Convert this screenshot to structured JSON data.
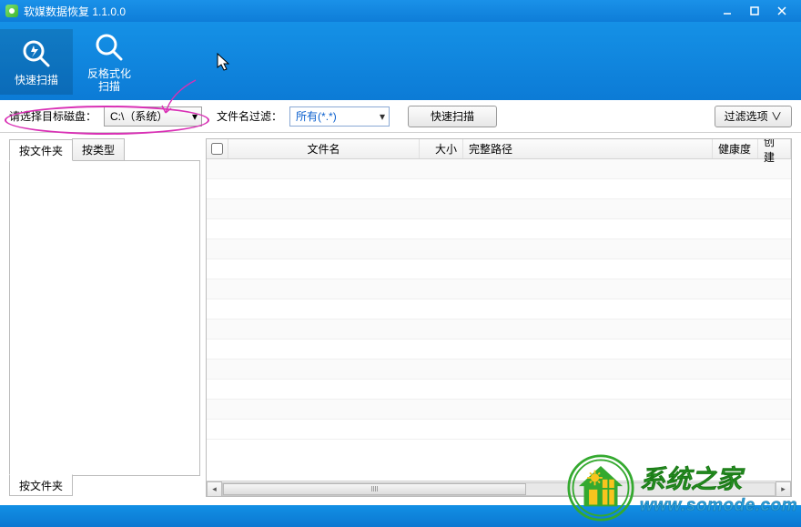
{
  "window": {
    "title": "软媒数据恢复 1.1.0.0"
  },
  "toolbar": {
    "quick_scan": "快速扫描",
    "unformat_line1": "反格式化",
    "unformat_line2": "扫描"
  },
  "filterbar": {
    "disk_label": "请选择目标磁盘：",
    "disk_value": "C:\\（系统）",
    "file_filter_label": "文件名过滤：",
    "file_filter_value": "所有(*.*)",
    "scan_btn": "快速扫描",
    "options_btn": "过滤选项 ∨"
  },
  "tabs": {
    "by_folder": "按文件夹",
    "by_type": "按类型"
  },
  "columns": {
    "filename": "文件名",
    "size": "大小",
    "fullpath": "完整路径",
    "health": "健康度",
    "created": "创建"
  },
  "watermark": {
    "line1": "系统之家",
    "line2": "www.somode.com"
  }
}
